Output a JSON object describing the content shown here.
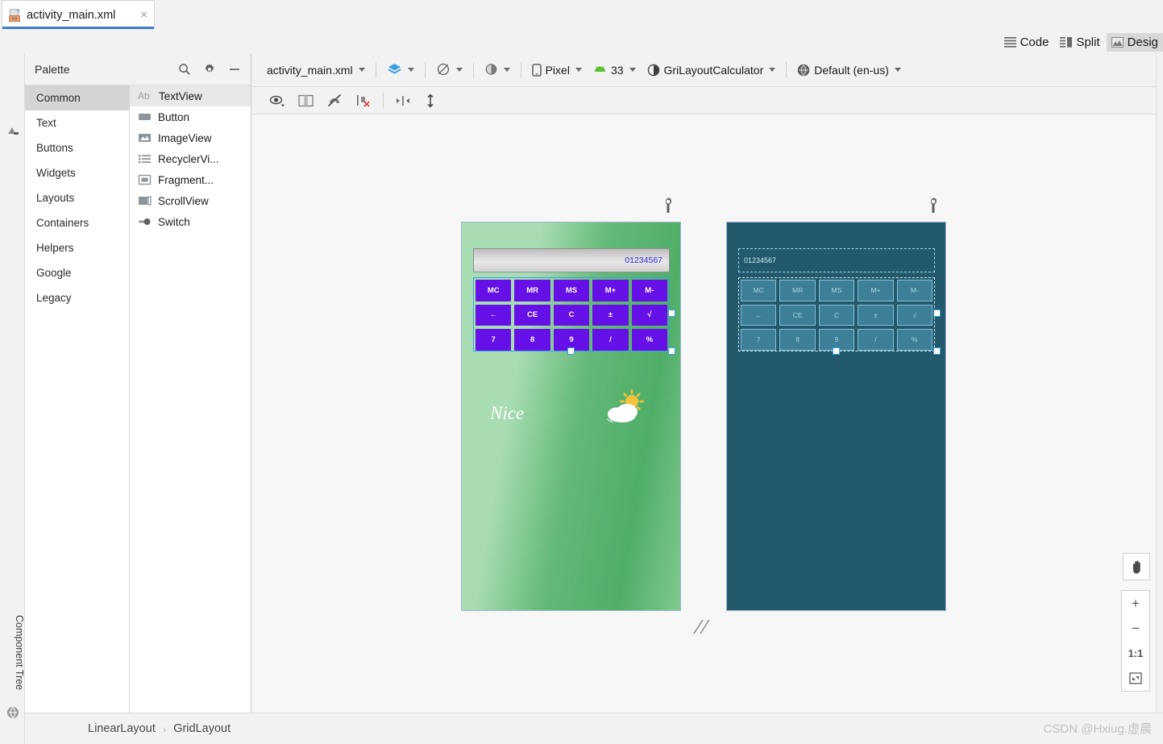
{
  "window": {
    "tab": {
      "label": "activity_main.xml",
      "close": "×",
      "icon": "xml-file-icon"
    }
  },
  "view_modes": [
    {
      "label": "Code",
      "icon": "code-lines-icon",
      "active": false
    },
    {
      "label": "Split",
      "icon": "split-view-icon",
      "active": false
    },
    {
      "label": "Desig",
      "icon": "design-view-icon",
      "active": true
    }
  ],
  "tool_windows": {
    "left_top": {
      "label": "Palette",
      "icon": "palette-icon"
    },
    "left_bottom": {
      "label": "Component Tree",
      "icon": "component-tree-icon"
    }
  },
  "palette": {
    "title": "Palette",
    "header_icons": [
      {
        "name": "search-icon",
        "glyph": "⌕"
      },
      {
        "name": "gear-icon",
        "glyph": "⚙"
      },
      {
        "name": "minimize-icon",
        "glyph": "—"
      }
    ],
    "categories": [
      {
        "label": "Common",
        "selected": true
      },
      {
        "label": "Text",
        "selected": false
      },
      {
        "label": "Buttons",
        "selected": false
      },
      {
        "label": "Widgets",
        "selected": false
      },
      {
        "label": "Layouts",
        "selected": false
      },
      {
        "label": "Containers",
        "selected": false
      },
      {
        "label": "Helpers",
        "selected": false
      },
      {
        "label": "Google",
        "selected": false
      },
      {
        "label": "Legacy",
        "selected": false
      }
    ],
    "items": [
      {
        "label": "TextView",
        "icon": "textview-ab-icon",
        "ab": "Ab",
        "selected": true
      },
      {
        "label": "Button",
        "icon": "button-icon",
        "ab": "",
        "selected": false
      },
      {
        "label": "ImageView",
        "icon": "imageview-icon",
        "ab": "",
        "selected": false
      },
      {
        "label": "RecyclerVi...",
        "icon": "recyclerview-list-icon",
        "ab": "",
        "selected": false
      },
      {
        "label": "Fragment...",
        "icon": "fragment-icon",
        "ab": "",
        "selected": false
      },
      {
        "label": "ScrollView",
        "icon": "scrollview-icon",
        "ab": "",
        "selected": false
      },
      {
        "label": "Switch",
        "icon": "switch-icon",
        "ab": "",
        "selected": false
      }
    ]
  },
  "design_toolbar": {
    "file_selector": "activity_main.xml",
    "view_toggle_icon": "layers-design-icon",
    "blueprint_toggle_icon": "blueprint-mode-icon",
    "theme_icon": "day-night-theme-icon",
    "device": {
      "label": "Pixel",
      "icon": "device-phone-icon"
    },
    "api": {
      "label": "33",
      "icon": "android-robot-icon"
    },
    "theme": {
      "label": "GriLayoutCalculator",
      "icon": "theme-circle-icon"
    },
    "locale": {
      "label": "Default (en-us)",
      "icon": "globe-icon"
    },
    "warning_icon": "warning-triangle-icon",
    "help_icon": "help-circle-icon",
    "help_glyph": "?"
  },
  "design_toolbar2": [
    {
      "name": "view-options-icon",
      "glyph": "eye"
    },
    {
      "name": "layout-columns-icon",
      "glyph": "columns"
    },
    {
      "name": "magnet-off-icon",
      "glyph": "magnet"
    },
    {
      "name": "clear-constraints-icon",
      "glyph": "clear"
    },
    {
      "name": "align-horizontal-icon",
      "glyph": "align"
    },
    {
      "name": "expand-vertical-icon",
      "glyph": "expand"
    }
  ],
  "preview": {
    "design": {
      "name": "design-preview",
      "wrench_icon": "wrench-icon",
      "display_value": "01234567",
      "art_text": "Nice",
      "weather_icon": "sun-behind-cloud-icon",
      "button_rows": [
        [
          "MC",
          "MR",
          "MS",
          "M+",
          "M-"
        ],
        [
          "←",
          "CE",
          "C",
          "±",
          "√"
        ],
        [
          "7",
          "8",
          "9",
          "/",
          "%"
        ]
      ]
    },
    "blueprint": {
      "name": "blueprint-preview",
      "wrench_icon": "wrench-icon",
      "display_value": "01234567",
      "button_rows": [
        [
          "MC",
          "MR",
          "MS",
          "M+",
          "M-"
        ],
        [
          "←",
          "CE",
          "C",
          "±",
          "√"
        ],
        [
          "7",
          "8",
          "9",
          "/",
          "%"
        ]
      ]
    }
  },
  "zoom_controls": [
    {
      "name": "pan-hand-button",
      "glyph": "✋"
    },
    {
      "name": "zoom-in-button",
      "glyph": "+"
    },
    {
      "name": "zoom-out-button",
      "glyph": "−"
    },
    {
      "name": "zoom-actual-size-button",
      "glyph": "1:1"
    },
    {
      "name": "zoom-fit-button",
      "glyph": "⛶"
    }
  ],
  "status_bar": {
    "breadcrumb": [
      {
        "label": "LinearLayout"
      },
      {
        "label": "GridLayout"
      }
    ],
    "separator": "›",
    "watermark": "CSDN @Hxiug.虚晨"
  }
}
